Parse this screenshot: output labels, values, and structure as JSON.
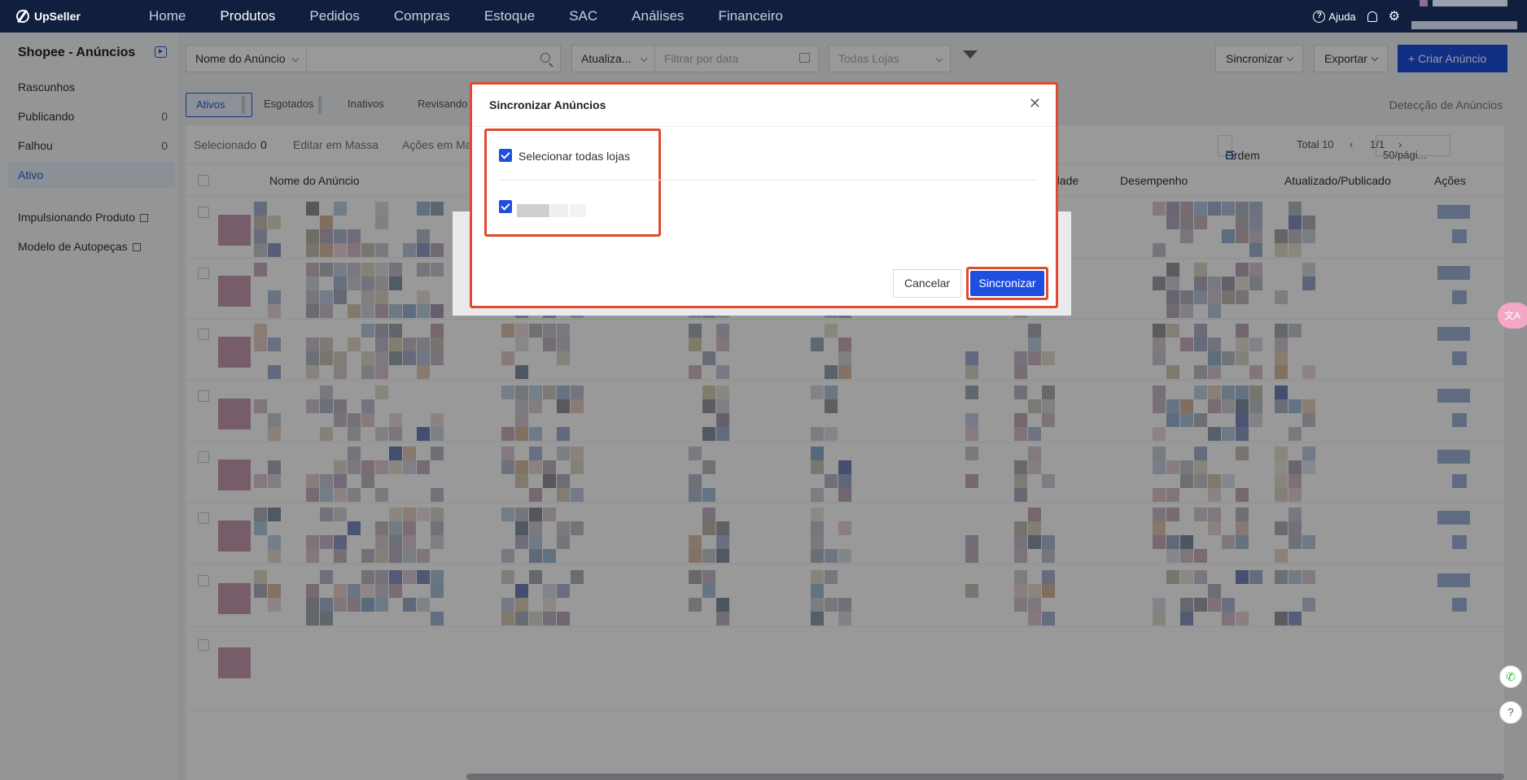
{
  "nav": {
    "brand": "UpSeller",
    "items": [
      "Home",
      "Produtos",
      "Pedidos",
      "Compras",
      "Estoque",
      "SAC",
      "Análises",
      "Financeiro"
    ],
    "active": "Produtos",
    "help": "Ajuda"
  },
  "sidebar": {
    "title": "Shopee - Anúncios",
    "items": [
      {
        "label": "Rascunhos",
        "count": ""
      },
      {
        "label": "Publicando",
        "count": "0"
      },
      {
        "label": "Falhou",
        "count": "0"
      },
      {
        "label": "Ativo",
        "count": ""
      }
    ],
    "links": [
      {
        "label": "Impulsionando Produto"
      },
      {
        "label": "Modelo de Autopeças"
      }
    ]
  },
  "filters": {
    "field_select": "Nome do Anúncio",
    "sort_select": "Atualiza...",
    "date_placeholder": "Filtrar por data",
    "stores_placeholder": "Todas Lojas",
    "sync_button": "Sincronizar",
    "export_button": "Exportar",
    "create_button": "+ Criar Anúncio"
  },
  "tabs": {
    "items": [
      "Ativos",
      "Esgotados",
      "Inativos",
      "Revisando"
    ],
    "detect": "Detecção de Anúncios"
  },
  "toolbar": {
    "selected_label": "Selecionado",
    "selected_count": "0",
    "mass_edit": "Editar em Massa",
    "mass_actions": "Ações em Ma",
    "order": "Ordem",
    "total": "Total 10",
    "page": "1/1",
    "per_page": "50/pági..."
  },
  "table": {
    "headers": {
      "name": "Nome do Anúncio",
      "qty": "dade",
      "performance": "Desempenho",
      "updated": "Atualizado/Publicado",
      "actions": "Ações"
    }
  },
  "modal": {
    "title": "Sincronizar Anúncios",
    "select_all": "Selecionar todas lojas",
    "cancel": "Cancelar",
    "confirm": "Sincronizar"
  },
  "widgets": {
    "translate": "文A",
    "whatsapp": "✆",
    "help": "?"
  }
}
